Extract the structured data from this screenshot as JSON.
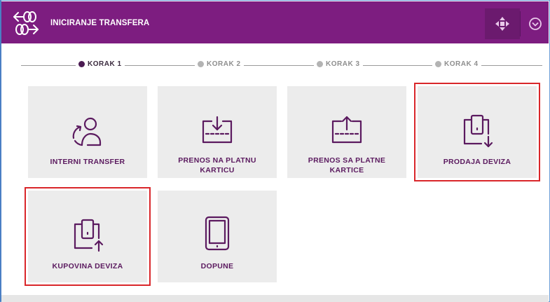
{
  "header": {
    "title": "INICIRANJE TRANSFERA",
    "logo_icon": "transfer-arrows-icon",
    "move_icon": "move-arrows-icon",
    "collapse_icon": "chevron-down-circle-icon"
  },
  "steps": [
    {
      "label": "KORAK 1",
      "active": true
    },
    {
      "label": "KORAK 2",
      "active": false
    },
    {
      "label": "KORAK 3",
      "active": false
    },
    {
      "label": "KORAK 4",
      "active": false
    }
  ],
  "tiles": [
    {
      "label": "INTERNI TRANSFER",
      "icon": "user-refresh-icon",
      "highlighted": false
    },
    {
      "label": "PRENOS NA PLATNU KARTICU",
      "icon": "card-download-icon",
      "highlighted": false
    },
    {
      "label": "PRENOS SA PLATNE KARTICE",
      "icon": "card-upload-icon",
      "highlighted": false
    },
    {
      "label": "PRODAJA DEVIZA",
      "icon": "wallet-down-icon",
      "highlighted": true
    },
    {
      "label": "KUPOVINA DEVIZA",
      "icon": "wallet-up-icon",
      "highlighted": true
    },
    {
      "label": "DOPUNE",
      "icon": "tablet-icon",
      "highlighted": false
    }
  ],
  "colors": {
    "header_bg": "#7d1d80",
    "accent": "#5b1a5f",
    "highlight": "#d9262a",
    "tile_bg": "#ececec"
  }
}
